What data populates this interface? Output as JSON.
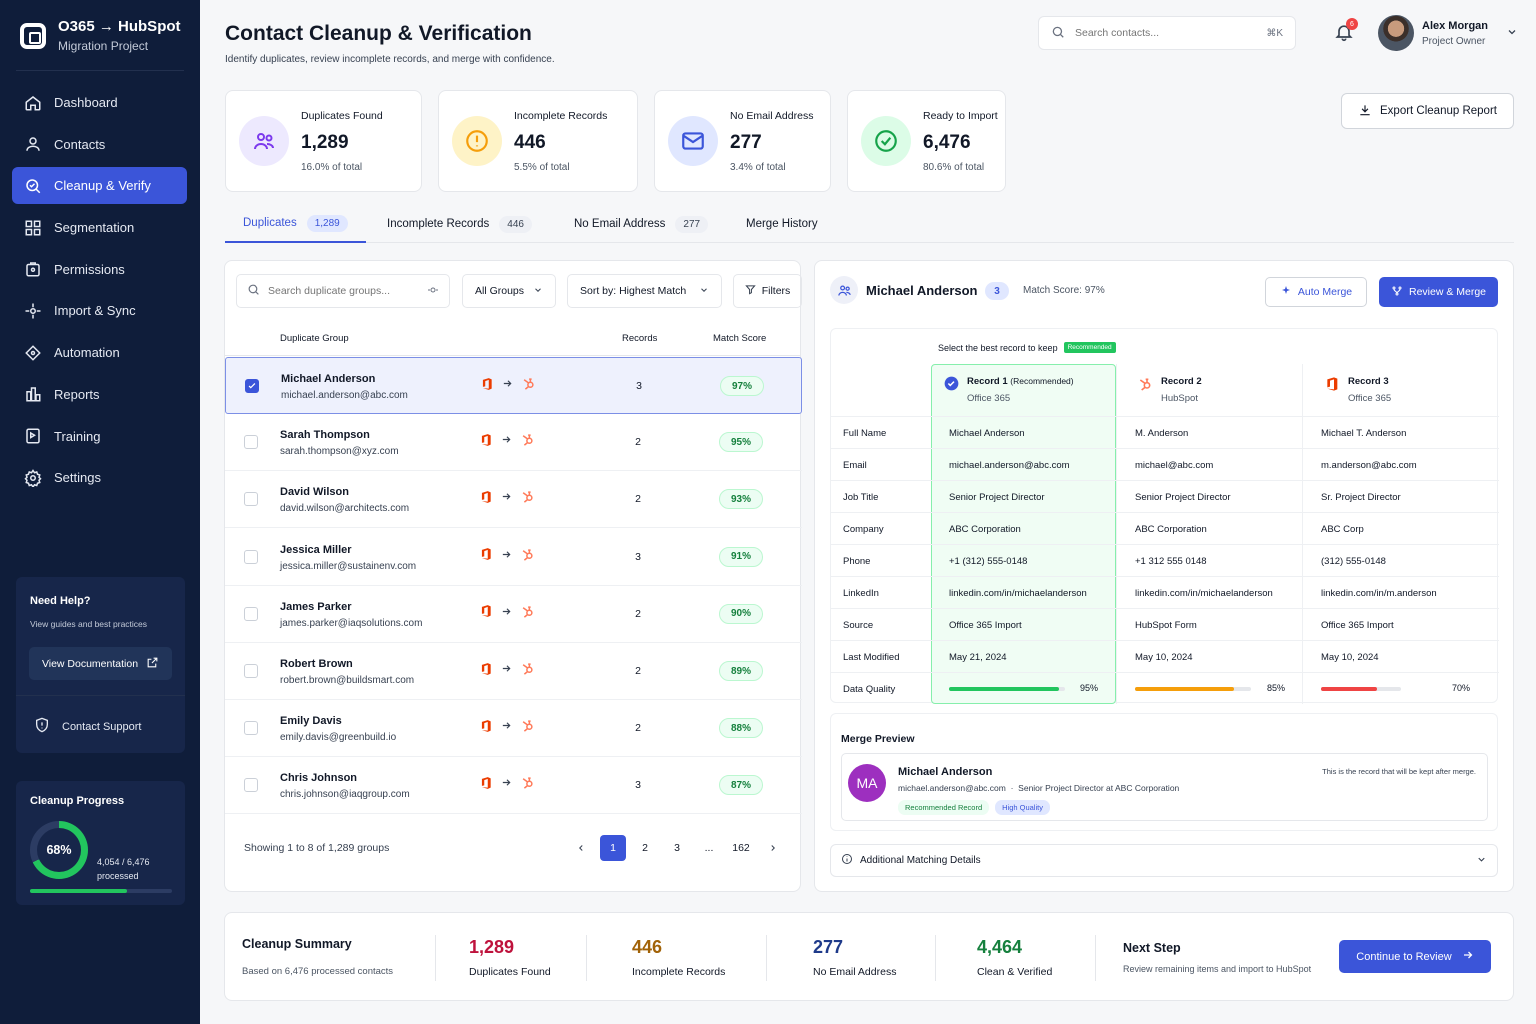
{
  "app": {
    "title": "O365 → HubSpot",
    "subtitle": "Migration Project"
  },
  "sidebar": {
    "items": [
      {
        "label": "Dashboard",
        "icon": "home-icon"
      },
      {
        "label": "Contacts",
        "icon": "user-icon"
      },
      {
        "label": "Cleanup & Verify",
        "icon": "search-check-icon",
        "active": true
      },
      {
        "label": "Segmentation",
        "icon": "grid-icon"
      },
      {
        "label": "Permissions",
        "icon": "lock-icon"
      },
      {
        "label": "Import & Sync",
        "icon": "sync-icon"
      },
      {
        "label": "Automation",
        "icon": "diamond-icon"
      },
      {
        "label": "Reports",
        "icon": "bar-chart-icon"
      },
      {
        "label": "Training",
        "icon": "book-icon"
      },
      {
        "label": "Settings",
        "icon": "gear-icon"
      }
    ],
    "help": {
      "title": "Need Help?",
      "subtitle": "View guides and best practices",
      "doc_button": "View Documentation",
      "support": "Contact Support"
    },
    "progress": {
      "title": "Cleanup Progress",
      "percent_label": "68%",
      "fraction": 0.68,
      "count": "4,054 / 6,476",
      "count_sub": "processed"
    }
  },
  "header": {
    "title": "Contact Cleanup & Verification",
    "subtitle": "Identify duplicates, review incomplete records, and merge with confidence.",
    "search_placeholder": "Search contacts...",
    "search_shortcut": "⌘K",
    "notifications": "6",
    "user_name": "Alex Morgan",
    "user_role": "Project Owner"
  },
  "stats": [
    {
      "label": "Duplicates Found",
      "value": "1,289",
      "pct": "16.0% of total",
      "color": "#7c3aed",
      "bg": "#ede9fe"
    },
    {
      "label": "Incomplete Records",
      "value": "446",
      "pct": "5.5% of total",
      "color": "#f59e0b",
      "bg": "#fef3c7"
    },
    {
      "label": "No Email Address",
      "value": "277",
      "pct": "3.4% of total",
      "color": "#3b55d9",
      "bg": "#e0e7ff"
    },
    {
      "label": "Ready to Import",
      "value": "6,476",
      "pct": "80.6% of total",
      "color": "#16a34a",
      "bg": "#dcfce7"
    }
  ],
  "export_label": "Export Cleanup Report",
  "tabs": [
    {
      "label": "Duplicates",
      "count": "1,289",
      "active": true
    },
    {
      "label": "Incomplete Records",
      "count": "446"
    },
    {
      "label": "No Email Address",
      "count": "277"
    },
    {
      "label": "Merge History",
      "count": ""
    }
  ],
  "left": {
    "search_placeholder": "Search duplicate groups...",
    "group_filter": "All Groups",
    "sort": "Sort by: Highest Match",
    "filters": "Filters",
    "columns": {
      "group": "Duplicate Group",
      "records": "Records",
      "score": "Match Score"
    },
    "rows": [
      {
        "name": "Michael Anderson",
        "email": "michael.anderson@abc.com",
        "records": "3",
        "score": "97%",
        "selected": true
      },
      {
        "name": "Sarah Thompson",
        "email": "sarah.thompson@xyz.com",
        "records": "2",
        "score": "95%"
      },
      {
        "name": "David Wilson",
        "email": "david.wilson@architects.com",
        "records": "2",
        "score": "93%"
      },
      {
        "name": "Jessica Miller",
        "email": "jessica.miller@sustainenv.com",
        "records": "3",
        "score": "91%"
      },
      {
        "name": "James Parker",
        "email": "james.parker@iaqsolutions.com",
        "records": "2",
        "score": "90%"
      },
      {
        "name": "Robert Brown",
        "email": "robert.brown@buildsmart.com",
        "records": "2",
        "score": "89%"
      },
      {
        "name": "Emily Davis",
        "email": "emily.davis@greenbuild.io",
        "records": "2",
        "score": "88%"
      },
      {
        "name": "Chris Johnson",
        "email": "chris.johnson@iaqgroup.com",
        "records": "3",
        "score": "87%"
      }
    ],
    "footer": "Showing 1 to 8 of 1,289 groups",
    "pages": [
      "1",
      "2",
      "3",
      "...",
      "162"
    ]
  },
  "detail": {
    "name": "Michael Anderson",
    "count": "3",
    "match": "Match Score: 97%",
    "auto_merge": "Auto Merge",
    "review_merge": "Review & Merge",
    "select_note": "Select the best record to keep",
    "recommended_badge": "Recommended",
    "records": [
      {
        "title": "Record 1",
        "tag": "(Recommended)",
        "source": "Office 365"
      },
      {
        "title": "Record 2",
        "tag": "",
        "source": "HubSpot"
      },
      {
        "title": "Record 3",
        "tag": "",
        "source": "Office 365"
      }
    ],
    "fields": [
      {
        "label": "Full Name",
        "values": [
          "Michael Anderson",
          "M. Anderson",
          "Michael T. Anderson"
        ]
      },
      {
        "label": "Email",
        "values": [
          "michael.anderson@abc.com",
          "michael@abc.com",
          "m.anderson@abc.com"
        ]
      },
      {
        "label": "Job Title",
        "values": [
          "Senior Project Director",
          "Senior Project Director",
          "Sr. Project Director"
        ]
      },
      {
        "label": "Company",
        "values": [
          "ABC Corporation",
          "ABC Corporation",
          "ABC Corp"
        ]
      },
      {
        "label": "Phone",
        "values": [
          "+1 (312) 555-0148",
          "+1 312 555 0148",
          "(312) 555-0148"
        ]
      },
      {
        "label": "LinkedIn",
        "values": [
          "linkedin.com/in/michaelanderson",
          "linkedin.com/in/michaelanderson",
          "linkedin.com/in/m.anderson"
        ]
      },
      {
        "label": "Source",
        "values": [
          "Office 365 Import",
          "HubSpot Form",
          "Office 365 Import"
        ]
      },
      {
        "label": "Last Modified",
        "values": [
          "May 21, 2024",
          "May 10, 2024",
          "May 10, 2024"
        ]
      }
    ],
    "quality_label": "Data Quality",
    "quality": [
      {
        "pct": "95%",
        "value": 0.95,
        "color": "#22c55e"
      },
      {
        "pct": "85%",
        "value": 0.85,
        "color": "#f59e0b"
      },
      {
        "pct": "70%",
        "value": 0.7,
        "color": "#ef4444"
      }
    ],
    "preview": {
      "title": "Merge Preview",
      "initials": "MA",
      "name": "Michael Anderson",
      "email": "michael.anderson@abc.com",
      "role": "Senior Project Director at ABC Corporation",
      "tag1": "Recommended Record",
      "tag2": "High Quality",
      "note": "This is the record that will be kept after merge."
    },
    "additional": "Additional Matching Details"
  },
  "summary": {
    "title": "Cleanup Summary",
    "subtitle": "Based on 6,476 processed contacts",
    "items": [
      {
        "value": "1,289",
        "label": "Duplicates Found",
        "color": "#be123c"
      },
      {
        "value": "446",
        "label": "Incomplete Records",
        "color": "#a16207"
      },
      {
        "value": "277",
        "label": "No Email Address",
        "color": "#1e3a8a"
      },
      {
        "value": "4,464",
        "label": "Clean & Verified",
        "color": "#15803d"
      }
    ],
    "next_title": "Next Step",
    "next_sub": "Review remaining items and import to HubSpot",
    "continue": "Continue to Review"
  }
}
